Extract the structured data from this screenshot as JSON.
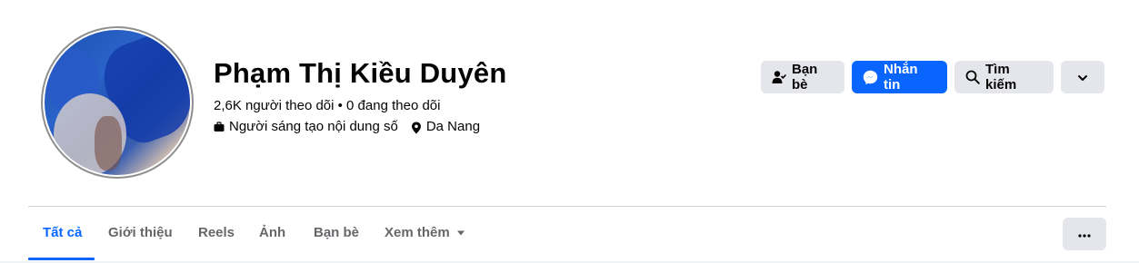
{
  "profile": {
    "name": "Phạm Thị Kiều Duyên",
    "followers_line": "2,6K người theo dõi • 0 đang theo dõi",
    "category": "Người sáng tạo nội dung số",
    "location": "Da Nang"
  },
  "actions": {
    "friends_label": "Bạn bè",
    "message_label": "Nhắn tin",
    "search_label": "Tìm kiếm"
  },
  "tabs": [
    {
      "label": "Tất cả"
    },
    {
      "label": "Giới thiệu"
    },
    {
      "label": "Reels"
    },
    {
      "label": "Ảnh"
    },
    {
      "label": "Bạn bè"
    },
    {
      "label": "Xem thêm"
    }
  ],
  "colors": {
    "accent": "#0866ff",
    "button_grey": "#e4e6eb",
    "muted_text": "#65676b"
  },
  "icons": {
    "friends": "friend-check-icon",
    "message": "messenger-icon",
    "search": "search-icon",
    "dropdown": "chevron-down-icon",
    "category": "briefcase-icon",
    "location": "map-pin-icon",
    "more": "ellipsis-icon"
  }
}
